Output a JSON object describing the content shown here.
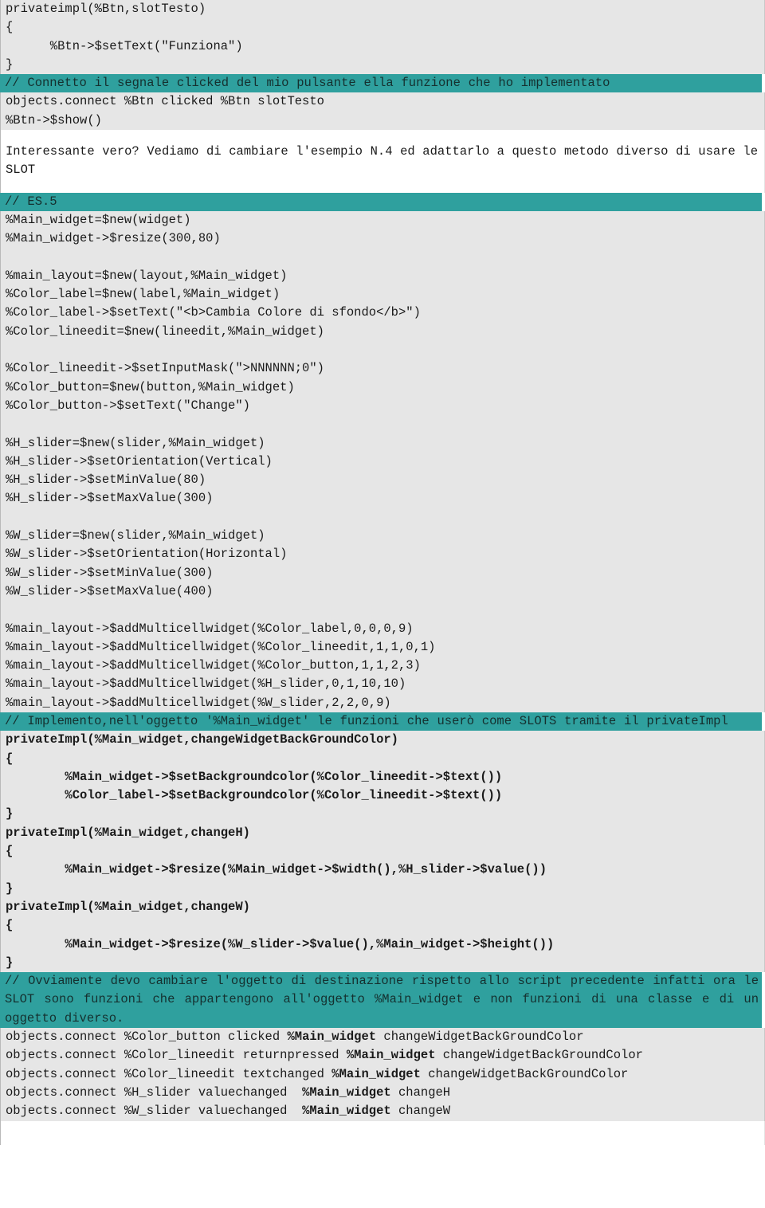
{
  "colors": {
    "highlight_teal": "#2fa09e",
    "code_background": "#e6e6e6",
    "page_background": "#ffffff",
    "text": "#1a1a1a",
    "rule": "#b9b9b9"
  },
  "block1": {
    "lines": [
      "privateimpl(%Btn,slotTesto)",
      "{",
      "      %Btn->$setText(\"Funziona\")",
      "}"
    ]
  },
  "comment1": "// Connetto il segnale clicked del mio pulsante ella funzione che ho implementato",
  "block2": {
    "lines": [
      "objects.connect %Btn clicked %Btn slotTesto",
      "%Btn->$show()"
    ]
  },
  "prose1": "Interessante vero? Vediamo di cambiare l'esempio N.4 ed adattarlo a questo metodo diverso di usare le SLOT",
  "comment2": "// ES.5",
  "block3": {
    "lines": [
      "%Main_widget=$new(widget)",
      "%Main_widget->$resize(300,80)",
      "",
      "%main_layout=$new(layout,%Main_widget)",
      "%Color_label=$new(label,%Main_widget)",
      "%Color_label->$setText(\"<b>Cambia Colore di sfondo</b>\")",
      "%Color_lineedit=$new(lineedit,%Main_widget)",
      "",
      "%Color_lineedit->$setInputMask(\">NNNNNN;0\")",
      "%Color_button=$new(button,%Main_widget)",
      "%Color_button->$setText(\"Change\")",
      "",
      "%H_slider=$new(slider,%Main_widget)",
      "%H_slider->$setOrientation(Vertical)",
      "%H_slider->$setMinValue(80)",
      "%H_slider->$setMaxValue(300)",
      "",
      "%W_slider=$new(slider,%Main_widget)",
      "%W_slider->$setOrientation(Horizontal)",
      "%W_slider->$setMinValue(300)",
      "%W_slider->$setMaxValue(400)",
      "",
      "%main_layout->$addMulticellwidget(%Color_label,0,0,0,9)",
      "%main_layout->$addMulticellwidget(%Color_lineedit,1,1,0,1)",
      "%main_layout->$addMulticellwidget(%Color_button,1,1,2,3)",
      "%main_layout->$addMulticellwidget(%H_slider,0,1,10,10)",
      "%main_layout->$addMulticellwidget(%W_slider,2,2,0,9)"
    ]
  },
  "comment3": "// Implemento,nell'oggetto '%Main_widget' le funzioni che userò come SLOTS tramite il privateImpl",
  "block4": {
    "lines": [
      {
        "text": "privateImpl(%Main_widget,changeWidgetBackGroundColor)",
        "bold": true
      },
      {
        "text": "{",
        "bold": true
      },
      {
        "text": "        %Main_widget->$setBackgroundcolor(%Color_lineedit->$text())",
        "bold": true
      },
      {
        "text": "        %Color_label->$setBackgroundcolor(%Color_lineedit->$text())",
        "bold": true
      },
      {
        "text": "}",
        "bold": true
      },
      {
        "text": "privateImpl(%Main_widget,changeH)",
        "bold": true
      },
      {
        "text": "{",
        "bold": true
      },
      {
        "text": "        %Main_widget->$resize(%Main_widget->$width(),%H_slider->$value())",
        "bold": true
      },
      {
        "text": "}",
        "bold": true
      },
      {
        "text": "privateImpl(%Main_widget,changeW)",
        "bold": true
      },
      {
        "text": "{",
        "bold": true
      },
      {
        "text": "        %Main_widget->$resize(%W_slider->$value(),%Main_widget->$height())",
        "bold": true
      },
      {
        "text": "}",
        "bold": true
      }
    ]
  },
  "comment4": "// Ovviamente devo cambiare l'oggetto di destinazione rispetto allo script precedente infatti ora le SLOT sono funzioni che appartengono all'oggetto %Main_widget e non funzioni di una classe e di un oggetto diverso.",
  "block5": {
    "lines": [
      {
        "pre": "objects.connect %Color_button clicked ",
        "bold": "%Main_widget",
        "post": " changeWidgetBackGroundColor"
      },
      {
        "pre": "objects.connect %Color_lineedit returnpressed ",
        "bold": "%Main_widget",
        "post": " changeWidgetBackGroundColor"
      },
      {
        "pre": "objects.connect %Color_lineedit textchanged ",
        "bold": "%Main_widget",
        "post": " changeWidgetBackGroundColor"
      },
      {
        "pre": "objects.connect %H_slider valuechanged  ",
        "bold": "%Main_widget",
        "post": " changeH"
      },
      {
        "pre": "objects.connect %W_slider valuechanged  ",
        "bold": "%Main_widget",
        "post": " changeW"
      }
    ]
  }
}
